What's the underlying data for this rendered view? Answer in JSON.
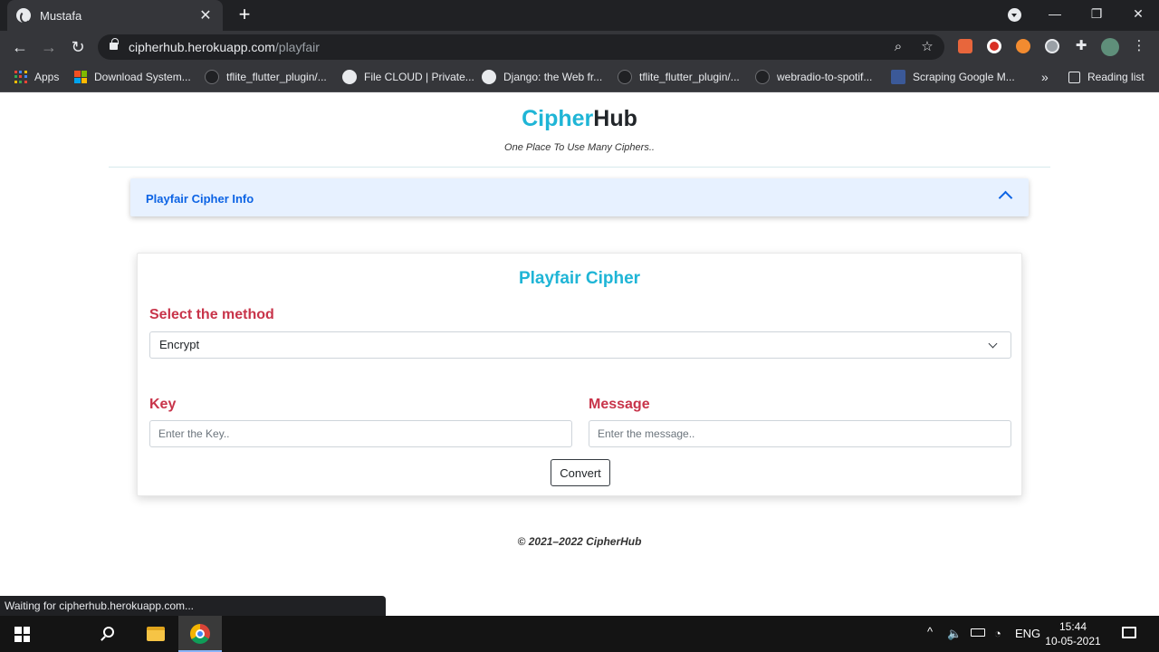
{
  "browser": {
    "tab": {
      "title": "Mustafa",
      "close": "✕"
    },
    "new_tab": "+",
    "window_controls": {
      "minimize": "—",
      "maximize": "❐",
      "close": "✕"
    },
    "address": {
      "domain": "cipherhub.herokuapp.com",
      "path": "/playfair"
    },
    "nav": {
      "back": "←",
      "forward": "→",
      "reload": "↻"
    },
    "bookmarks": [
      {
        "label": "Apps",
        "icon": "apps-grid-icon"
      },
      {
        "label": "Download System...",
        "icon": "microsoft-icon"
      },
      {
        "label": "tflite_flutter_plugin/...",
        "icon": "github-icon"
      },
      {
        "label": "File CLOUD | Private...",
        "icon": "globe-icon"
      },
      {
        "label": "Django: the Web fr...",
        "icon": "globe-icon"
      },
      {
        "label": "tflite_flutter_plugin/...",
        "icon": "github-icon"
      },
      {
        "label": "webradio-to-spotif...",
        "icon": "github-icon"
      },
      {
        "label": "Scraping Google M...",
        "icon": "bookmark-site-icon"
      }
    ],
    "bookmarks_overflow": "»",
    "reading_list": "Reading list"
  },
  "page": {
    "brand": {
      "part1": "Cipher",
      "part2": "Hub"
    },
    "tagline": "One Place To Use Many Ciphers..",
    "accordion": {
      "title": "Playfair Cipher Info"
    },
    "card": {
      "title": "Playfair Cipher",
      "method_label": "Select the method",
      "method_value": "Encrypt",
      "key_label": "Key",
      "key_placeholder": "Enter the Key..",
      "message_label": "Message",
      "message_placeholder": "Enter the message..",
      "convert_label": "Convert"
    },
    "footer": "© 2021–2022 CipherHub"
  },
  "status_bar": "Waiting for cipherhub.herokuapp.com...",
  "taskbar": {
    "language": "ENG",
    "time": "15:44",
    "date": "10-05-2021"
  },
  "colors": {
    "brand_accent": "#1fb5d6",
    "label_red": "#c8344a",
    "accordion_bg": "#e7f1ff",
    "accordion_text": "#0c63e4"
  }
}
